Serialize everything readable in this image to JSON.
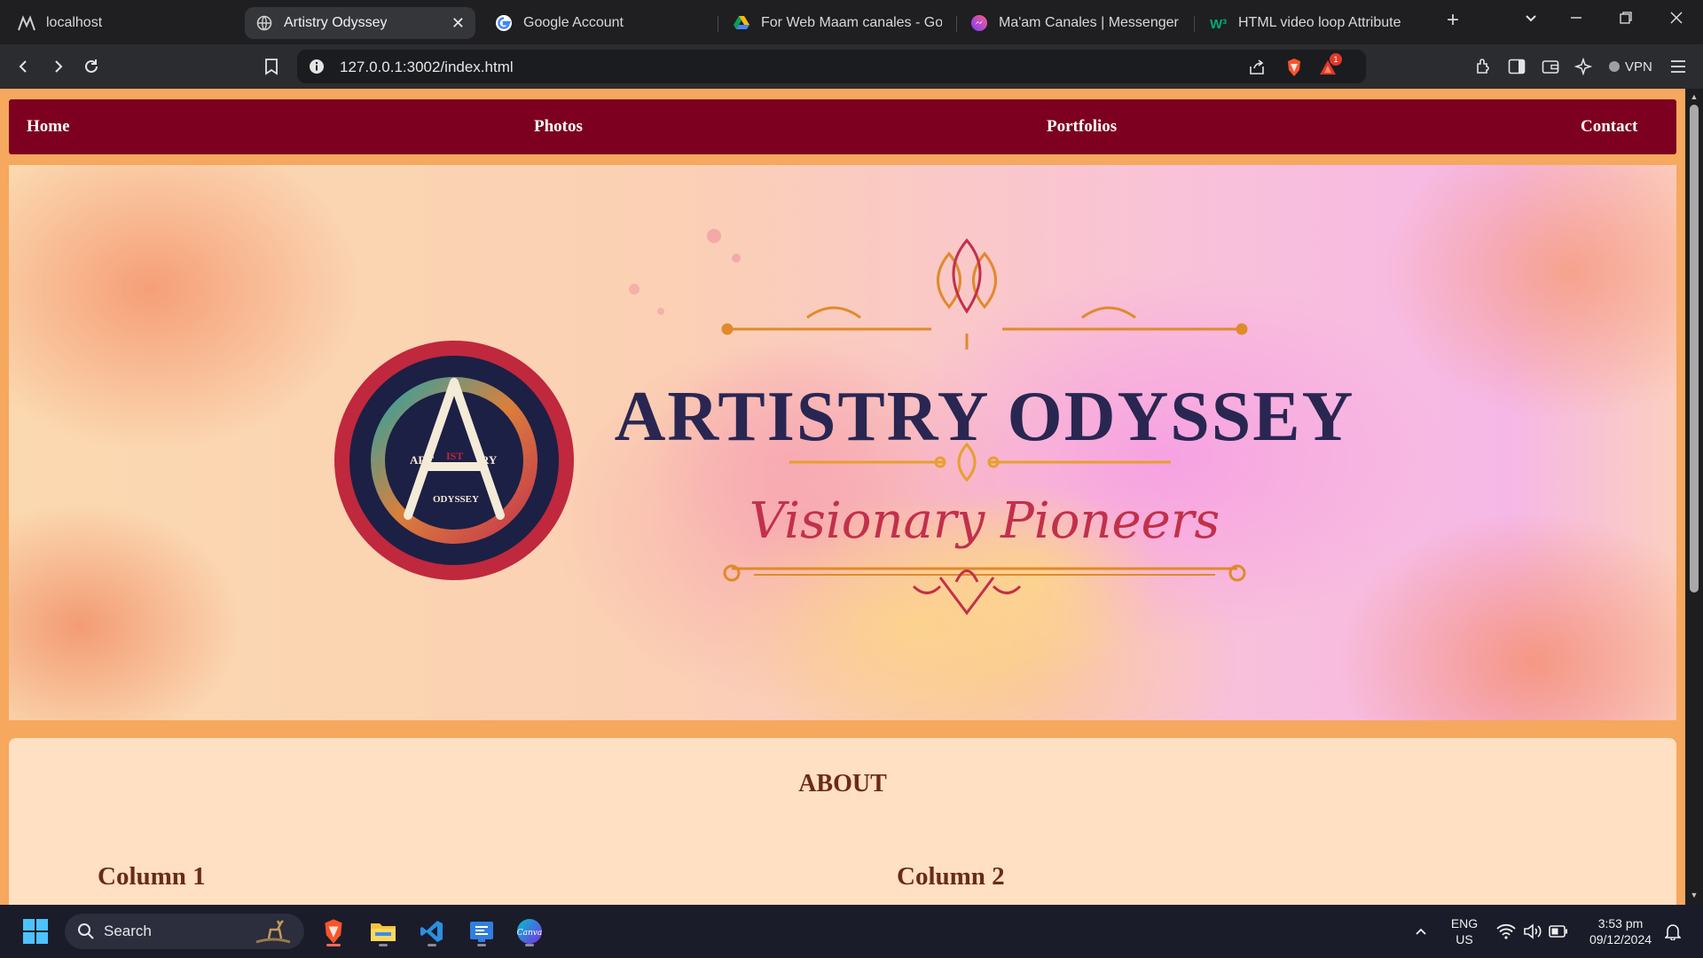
{
  "browser": {
    "tabs": [
      {
        "label": "localhost",
        "icon": "localhost-favicon-icon",
        "active": false
      },
      {
        "label": "Artistry Odyssey",
        "icon": "globe-icon",
        "active": true
      },
      {
        "label": "Google Account",
        "icon": "google-icon",
        "active": false
      },
      {
        "label": "For Web Maam canales - Goog",
        "icon": "google-drive-icon",
        "active": false
      },
      {
        "label": "Ma'am Canales | Messenger",
        "icon": "messenger-icon",
        "active": false
      },
      {
        "label": "HTML video loop Attribute",
        "icon": "w3schools-icon",
        "active": false
      }
    ],
    "close_tab_glyph": "✕",
    "new_tab_glyph": "+",
    "url": "127.0.0.1:3002/index.html",
    "shields_badge": "1",
    "vpn_label": "VPN"
  },
  "site": {
    "nav": {
      "home": "Home",
      "photos": "Photos",
      "portfolios": "Portfolios",
      "contact": "Contact"
    },
    "banner": {
      "logo_top_letter": "A",
      "logo_ring_left": "ART",
      "logo_ring_mid": "IST",
      "logo_ring_right": "RY",
      "logo_bottom": "ODYSSEY",
      "title": "ARTISTRY ODYSSEY",
      "subtitle": "Visionary Pioneers"
    },
    "about": {
      "heading": "ABOUT",
      "column1": "Column 1",
      "column2": "Column 2"
    }
  },
  "taskbar": {
    "search_label": "Search",
    "lang_line1": "ENG",
    "lang_line2": "US",
    "time": "3:53 pm",
    "date": "09/12/2024"
  },
  "colors": {
    "nav_bg": "#7d0020",
    "page_bg": "#f5a85e",
    "about_bg": "#ffe0c2",
    "about_text": "#6b2a16"
  }
}
